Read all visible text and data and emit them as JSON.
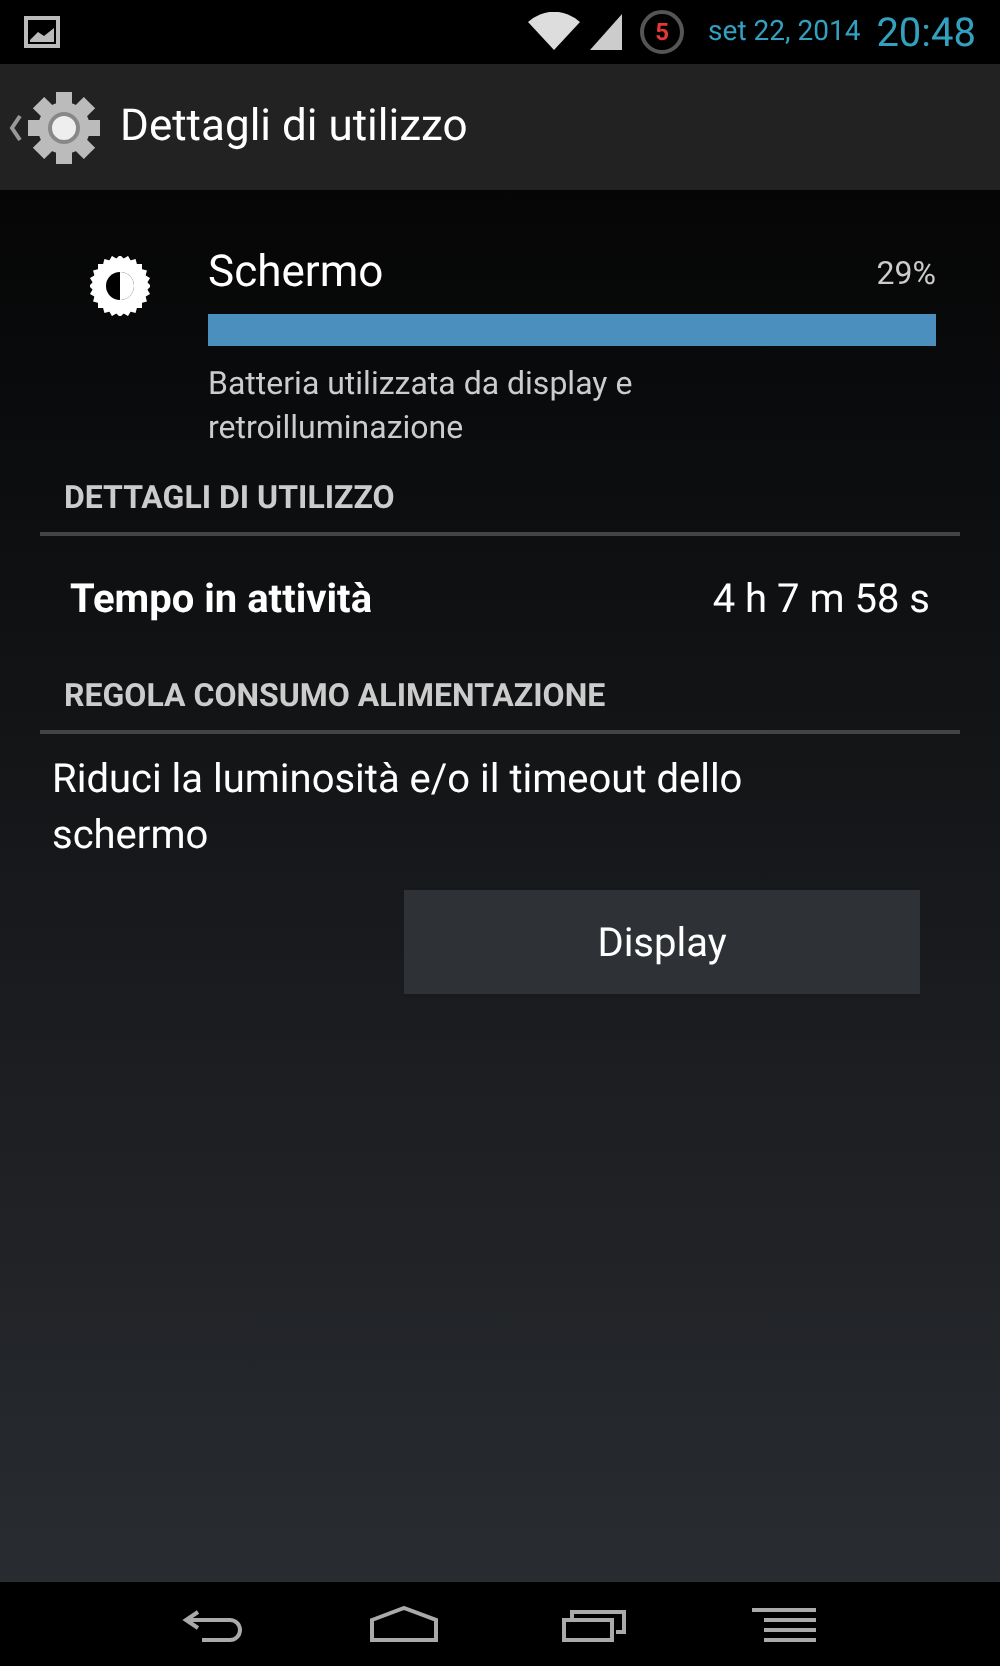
{
  "status_bar": {
    "notification_count": "5",
    "date": "set 22, 2014",
    "time": "20:48"
  },
  "action_bar": {
    "title": "Dettagli di utilizzo"
  },
  "usage_item": {
    "title": "Schermo",
    "percent": "29%",
    "level": 1,
    "description": "Batteria utilizzata da display e retroilluminazione"
  },
  "sections": [
    {
      "header": "DETTAGLI DI UTILIZZO",
      "rows": [
        {
          "label": "Tempo in attività",
          "value": "4 h 7 m 58 s"
        }
      ]
    },
    {
      "header": "REGOLA CONSUMO ALIMENTAZIONE",
      "text": "Riduci la luminosità e/o il timeout dello schermo",
      "button": "Display"
    }
  ]
}
